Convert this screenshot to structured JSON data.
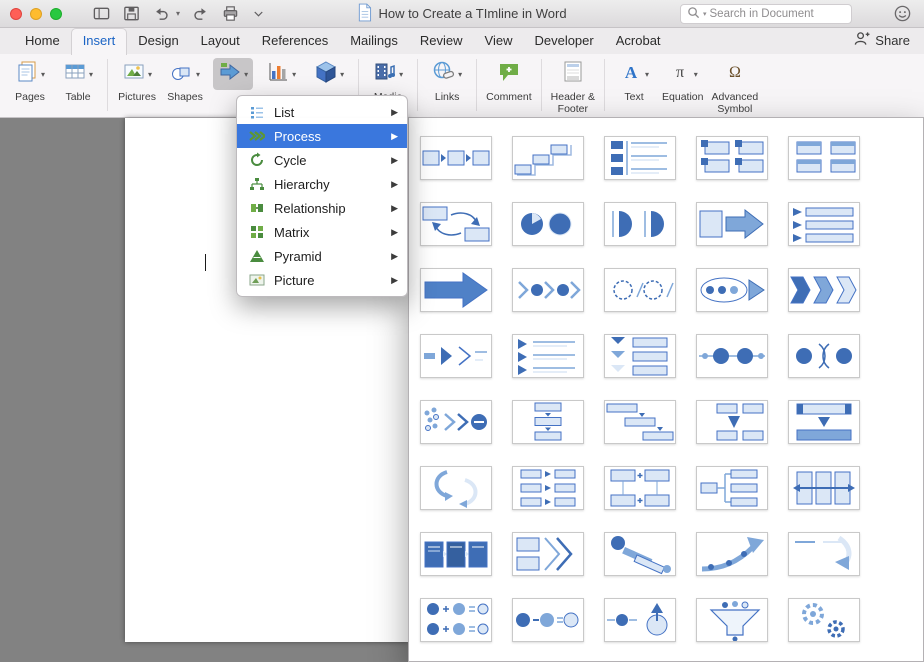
{
  "titlebar": {
    "title": "How to Create a TImline in Word",
    "search_placeholder": "Search in Document",
    "tools": [
      {
        "icon": "view-icon"
      },
      {
        "icon": "save-icon"
      },
      {
        "icon": "undo-icon",
        "caret": true
      },
      {
        "icon": "redo-icon"
      },
      {
        "icon": "print-icon"
      },
      {
        "icon": "toolbar-more-icon"
      }
    ]
  },
  "tabs": {
    "items": [
      "Home",
      "Insert",
      "Design",
      "Layout",
      "References",
      "Mailings",
      "Review",
      "View",
      "Developer",
      "Acrobat"
    ],
    "selected": "Insert",
    "share_label": "Share"
  },
  "ribbon": {
    "buttons": [
      {
        "name": "pages",
        "label": "Pages",
        "icon": "pages-icon",
        "caret": true
      },
      {
        "name": "table",
        "label": "Table",
        "icon": "table-icon",
        "caret": true
      },
      {
        "separator": true
      },
      {
        "name": "pictures",
        "label": "Pictures",
        "icon": "pictures-icon",
        "caret": true
      },
      {
        "name": "shapes",
        "label": "Shapes",
        "icon": "shapes-icon",
        "caret": true
      },
      {
        "name": "smartart",
        "label": "",
        "icon": "smartart-icon",
        "caret": true,
        "pressed": true
      },
      {
        "name": "chart",
        "label": "",
        "icon": "chart-icon",
        "caret": true
      },
      {
        "name": "3d-model",
        "label": "",
        "icon": "cube-icon",
        "caret": true
      },
      {
        "separator": true
      },
      {
        "name": "media",
        "label": "Media",
        "icon": "media-icon",
        "caret": true
      },
      {
        "separator": true
      },
      {
        "name": "links",
        "label": "Links",
        "icon": "links-icon",
        "caret": true
      },
      {
        "separator": true
      },
      {
        "name": "comment",
        "label": "Comment",
        "icon": "comment-icon",
        "caret": false
      },
      {
        "separator": true
      },
      {
        "name": "header-footer",
        "label": "Header &\nFooter",
        "icon": "header-footer-icon",
        "caret": false
      },
      {
        "separator": true
      },
      {
        "name": "text",
        "label": "Text",
        "icon": "text-icon",
        "caret": true
      },
      {
        "name": "equation",
        "label": "Equation",
        "icon": "equation-icon",
        "caret": true
      },
      {
        "name": "advanced-symbol",
        "label": "Advanced\nSymbol",
        "icon": "symbol-icon",
        "caret": false
      }
    ]
  },
  "menu": {
    "items": [
      {
        "label": "List",
        "icon": "list-icon",
        "submenu": true
      },
      {
        "label": "Process",
        "icon": "process-icon",
        "submenu": true,
        "selected": true
      },
      {
        "label": "Cycle",
        "icon": "cycle-icon",
        "submenu": true
      },
      {
        "label": "Hierarchy",
        "icon": "hierarchy-icon",
        "submenu": true
      },
      {
        "label": "Relationship",
        "icon": "relationship-icon",
        "submenu": true
      },
      {
        "label": "Matrix",
        "icon": "matrix-icon",
        "submenu": true
      },
      {
        "label": "Pyramid",
        "icon": "pyramid-icon",
        "submenu": true
      },
      {
        "label": "Picture",
        "icon": "picture-icon",
        "submenu": true
      }
    ]
  },
  "gallery": {
    "columns": 5,
    "thumbnails": [
      {
        "icon": "basic-process"
      },
      {
        "icon": "step-process"
      },
      {
        "icon": "accent-list"
      },
      {
        "icon": "alt-boxes"
      },
      {
        "icon": "accent-boxes"
      },
      {
        "icon": "loop-boxes"
      },
      {
        "icon": "pie-circles"
      },
      {
        "icon": "half-circles"
      },
      {
        "icon": "box-arrow"
      },
      {
        "icon": "bars-arrows"
      },
      {
        "icon": "big-arrow"
      },
      {
        "icon": "circle-chevrons"
      },
      {
        "icon": "dashed-circles"
      },
      {
        "icon": "oval-arrow"
      },
      {
        "icon": "chevron-list"
      },
      {
        "icon": "dash-chevron"
      },
      {
        "icon": "chevron-lines"
      },
      {
        "icon": "vchevron-list"
      },
      {
        "icon": "linked-circles"
      },
      {
        "icon": "paren-circles"
      },
      {
        "icon": "dots-chevron-circle"
      },
      {
        "icon": "flow-down"
      },
      {
        "icon": "stagger-flow"
      },
      {
        "icon": "grid-flow"
      },
      {
        "icon": "bars-down"
      },
      {
        "icon": "s-arrows"
      },
      {
        "icon": "flow-grid"
      },
      {
        "icon": "plus-boxes"
      },
      {
        "icon": "org-grid"
      },
      {
        "icon": "panels-arrow"
      },
      {
        "icon": "dark-boxes"
      },
      {
        "icon": "boxes-arrow"
      },
      {
        "icon": "circle-diag-bars"
      },
      {
        "icon": "ascend-arrow"
      },
      {
        "icon": "swoosh-arrow"
      },
      {
        "icon": "circles-plus"
      },
      {
        "icon": "minus-circles"
      },
      {
        "icon": "up-arrow-circles"
      },
      {
        "icon": "funnel"
      },
      {
        "icon": "gears"
      }
    ]
  },
  "colors": {
    "menu_selection": "#3a77dd",
    "smartart_blue": "#4472c4",
    "smartart_green": "#4a8c3f",
    "tab_accent": "#1b64c5"
  }
}
